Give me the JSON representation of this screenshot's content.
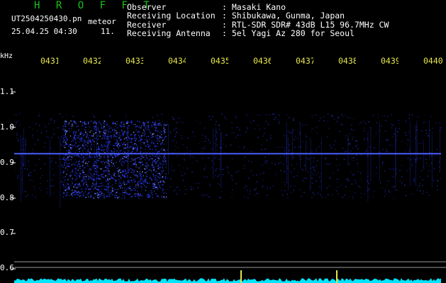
{
  "header": {
    "brand": "H R O F F T",
    "filename": "UT2504250430.pn",
    "filename_suffix": "meteor",
    "datetime": "25.04.25 04:30",
    "index": "11.",
    "info": [
      {
        "label": "Observer",
        "value": ": Masaki Kano"
      },
      {
        "label": "Receiving Location",
        "value": ": Shibukawa, Gunma, Japan"
      },
      {
        "label": "Receiver",
        "value": ": RTL-SDR SDR# 43dB L15 96.7MHz CW"
      },
      {
        "label": "Receiving Antenna",
        "value": ": 5el Yagi Az 280 for Seoul"
      }
    ]
  },
  "axis": {
    "y_unit": "kHz",
    "y_ticks": [
      "1.1",
      "1.0",
      "0.9",
      "0.8",
      "0.7",
      "0.6"
    ],
    "time_ticks": [
      "0431",
      "0432",
      "0433",
      "0434",
      "0435",
      "0436",
      "0437",
      "0438",
      "0439",
      "0440"
    ]
  },
  "colors": {
    "background": "#000000",
    "brand": "#18c418",
    "text": "#ffffff",
    "time_ticks": "#e6e64a",
    "carrier": "#4a5cff",
    "signal_noise": "#2a3cff",
    "bottom_trace": "#00e5ff",
    "guide_lines": "#9a9a9a"
  },
  "spectrogram": {
    "y_range_khz": [
      0.6,
      1.1
    ],
    "carrier_khz": 0.925,
    "burst_band_khz": [
      0.8,
      1.02
    ],
    "burst_time_range": [
      "0430",
      "0433"
    ]
  }
}
